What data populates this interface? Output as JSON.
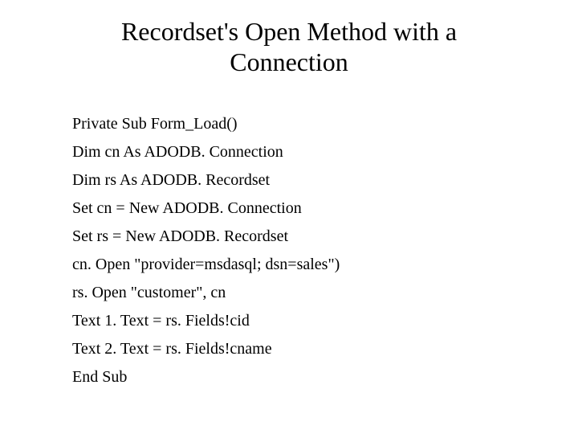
{
  "title": "Recordset's Open Method with a Connection",
  "code": {
    "l0": "Private Sub Form_Load()",
    "l1": "Dim cn As ADODB. Connection",
    "l2": "Dim rs As ADODB. Recordset",
    "l3": "Set cn = New ADODB. Connection",
    "l4": "Set rs = New ADODB. Recordset",
    "l5": "cn. Open \"provider=msdasql; dsn=sales\")",
    "l6": "rs. Open \"customer\", cn",
    "l7": "Text 1. Text = rs. Fields!cid",
    "l8": "Text 2. Text = rs. Fields!cname",
    "l9": "End Sub"
  }
}
